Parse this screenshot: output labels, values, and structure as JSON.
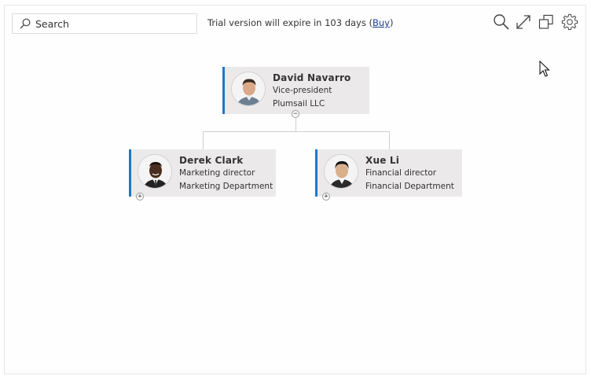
{
  "search": {
    "placeholder": "Search"
  },
  "trial": {
    "text": "Trial version will expire in 103 days (",
    "link": "Buy",
    "close": ")"
  },
  "toolbar": {
    "icons": [
      "search-icon",
      "expand-icon",
      "copy-windows-icon",
      "gear-icon"
    ]
  },
  "colors": {
    "accent": "#1e78c8",
    "card_bg": "#ebe9e9",
    "connector": "#cfcfcf"
  },
  "orgchart": {
    "root": {
      "name": "David Navarro",
      "title": "Vice-president",
      "department": "Plumsail LLC",
      "expander": "−"
    },
    "children": [
      {
        "name": "Derek Clark",
        "title": "Marketing director",
        "department": "Marketing Department",
        "expander": "+"
      },
      {
        "name": "Xue Li",
        "title": "Financial director",
        "department": "Financial Department",
        "expander": "+"
      }
    ]
  }
}
